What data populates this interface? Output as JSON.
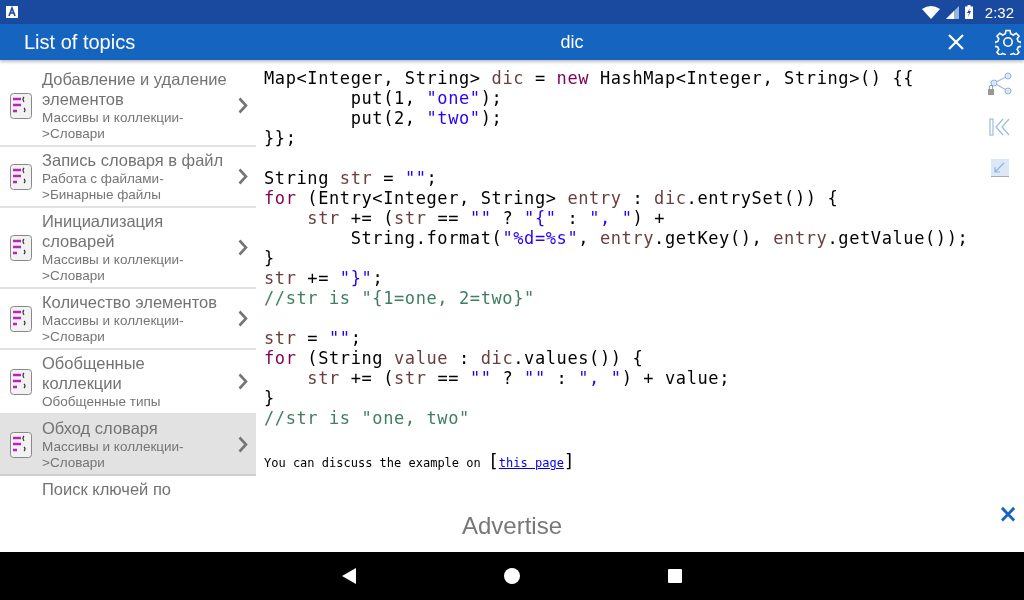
{
  "status_bar": {
    "time": "2:32"
  },
  "app_bar": {
    "title": "List of topics",
    "search_query": "dic"
  },
  "topics": [
    {
      "title": "Добавление и удаление элементов",
      "subtitle": "Массивы и коллекции->Словари",
      "selected": false
    },
    {
      "title": "Запись словаря в файл",
      "subtitle": "Работа с файлами->Бинарные файлы",
      "selected": false
    },
    {
      "title": "Инициализация словарей",
      "subtitle": "Массивы и коллекции->Словари",
      "selected": false
    },
    {
      "title": "Количество элементов",
      "subtitle": "Массивы и коллекции->Словари",
      "selected": false
    },
    {
      "title": "Обобщенные коллекции",
      "subtitle": "Обобщенные типы",
      "selected": false
    },
    {
      "title": "Обход словаря",
      "subtitle": "Массивы и коллекции->Словари",
      "selected": true
    },
    {
      "title": "Поиск ключей по",
      "selected": false
    }
  ],
  "code_lines": [
    {
      "kind": "code",
      "tokens": [
        {
          "text": "Map<Integer, String> ",
          "kind": "plain"
        },
        {
          "text": "dic",
          "kind": "var"
        },
        {
          "text": " = ",
          "kind": "plain"
        },
        {
          "text": "new",
          "kind": "keyword"
        },
        {
          "text": " HashMap<Integer, String>() {{",
          "kind": "plain"
        }
      ]
    },
    {
      "kind": "code",
      "tokens": [
        {
          "text": "        put(1, ",
          "kind": "plain"
        },
        {
          "text": "\"one\"",
          "kind": "string"
        },
        {
          "text": ");",
          "kind": "plain"
        }
      ]
    },
    {
      "kind": "code",
      "tokens": [
        {
          "text": "        put(2, ",
          "kind": "plain"
        },
        {
          "text": "\"two\"",
          "kind": "string"
        },
        {
          "text": ");",
          "kind": "plain"
        }
      ]
    },
    {
      "kind": "code",
      "tokens": [
        {
          "text": "}};",
          "kind": "plain"
        }
      ]
    },
    {
      "kind": "blank"
    },
    {
      "kind": "code",
      "tokens": [
        {
          "text": "String ",
          "kind": "plain"
        },
        {
          "text": "str",
          "kind": "var"
        },
        {
          "text": " = ",
          "kind": "plain"
        },
        {
          "text": "\"\"",
          "kind": "string"
        },
        {
          "text": ";",
          "kind": "plain"
        }
      ]
    },
    {
      "kind": "code",
      "tokens": [
        {
          "text": "for",
          "kind": "keyword"
        },
        {
          "text": " (Entry<Integer, String> ",
          "kind": "plain"
        },
        {
          "text": "entry",
          "kind": "var"
        },
        {
          "text": " : ",
          "kind": "plain"
        },
        {
          "text": "dic",
          "kind": "var"
        },
        {
          "text": ".entrySet()) {",
          "kind": "plain"
        }
      ]
    },
    {
      "kind": "code",
      "tokens": [
        {
          "text": "    str",
          "kind": "var"
        },
        {
          "text": " += (",
          "kind": "plain"
        },
        {
          "text": "str",
          "kind": "var"
        },
        {
          "text": " == ",
          "kind": "plain"
        },
        {
          "text": "\"\"",
          "kind": "string"
        },
        {
          "text": " ? ",
          "kind": "plain"
        },
        {
          "text": "\"{\"",
          "kind": "string"
        },
        {
          "text": " : ",
          "kind": "plain"
        },
        {
          "text": "\", \"",
          "kind": "string"
        },
        {
          "text": ") +",
          "kind": "plain"
        }
      ]
    },
    {
      "kind": "code",
      "tokens": [
        {
          "text": "        String.format(",
          "kind": "plain"
        },
        {
          "text": "\"%d=%s\"",
          "kind": "string"
        },
        {
          "text": ", ",
          "kind": "plain"
        },
        {
          "text": "entry",
          "kind": "var"
        },
        {
          "text": ".getKey(), ",
          "kind": "plain"
        },
        {
          "text": "entry",
          "kind": "var"
        },
        {
          "text": ".getValue());",
          "kind": "plain"
        }
      ]
    },
    {
      "kind": "code",
      "tokens": [
        {
          "text": "}",
          "kind": "plain"
        }
      ]
    },
    {
      "kind": "code",
      "tokens": [
        {
          "text": "str",
          "kind": "var"
        },
        {
          "text": " += ",
          "kind": "plain"
        },
        {
          "text": "\"}\"",
          "kind": "string"
        },
        {
          "text": ";",
          "kind": "plain"
        }
      ]
    },
    {
      "kind": "code",
      "tokens": [
        {
          "text": "//str is \"{1=one, 2=two}\"",
          "kind": "comment"
        }
      ]
    },
    {
      "kind": "blank"
    },
    {
      "kind": "code",
      "tokens": [
        {
          "text": "str",
          "kind": "var"
        },
        {
          "text": " = ",
          "kind": "plain"
        },
        {
          "text": "\"\"",
          "kind": "string"
        },
        {
          "text": ";",
          "kind": "plain"
        }
      ]
    },
    {
      "kind": "code",
      "tokens": [
        {
          "text": "for",
          "kind": "keyword"
        },
        {
          "text": " (String ",
          "kind": "plain"
        },
        {
          "text": "value",
          "kind": "var"
        },
        {
          "text": " : ",
          "kind": "plain"
        },
        {
          "text": "dic",
          "kind": "var"
        },
        {
          "text": ".values()) {",
          "kind": "plain"
        }
      ]
    },
    {
      "kind": "code",
      "tokens": [
        {
          "text": "    str",
          "kind": "var"
        },
        {
          "text": " += (",
          "kind": "plain"
        },
        {
          "text": "str",
          "kind": "var"
        },
        {
          "text": " == ",
          "kind": "plain"
        },
        {
          "text": "\"\"",
          "kind": "string"
        },
        {
          "text": " ? ",
          "kind": "plain"
        },
        {
          "text": "\"\"",
          "kind": "string"
        },
        {
          "text": " : ",
          "kind": "plain"
        },
        {
          "text": "\", \"",
          "kind": "string"
        },
        {
          "text": ") + value;",
          "kind": "plain"
        }
      ]
    },
    {
      "kind": "code",
      "tokens": [
        {
          "text": "}",
          "kind": "plain"
        }
      ]
    },
    {
      "kind": "code",
      "tokens": [
        {
          "text": "//str is \"one, two\"",
          "kind": "comment"
        }
      ]
    }
  ],
  "discussion": {
    "text": "You can discuss the example on",
    "open_bracket": "[",
    "link": "this page",
    "close_bracket": "]"
  },
  "ad_banner": {
    "label": "Advertise",
    "close": "×"
  }
}
